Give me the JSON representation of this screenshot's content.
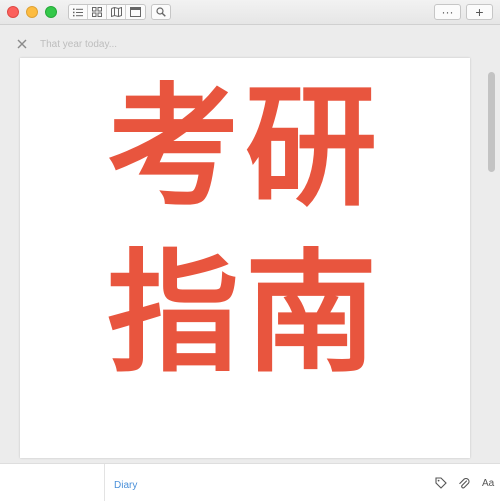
{
  "window": {
    "controls": [
      "close",
      "minimize",
      "zoom"
    ]
  },
  "toolbar": {
    "view_buttons": [
      {
        "icon": "list-icon"
      },
      {
        "icon": "grid-icon"
      },
      {
        "icon": "map-icon"
      },
      {
        "icon": "calendar-icon"
      }
    ],
    "search_icon": "magnifier-icon",
    "more_label": "···",
    "add_label": "+"
  },
  "entry": {
    "title_placeholder": "That year today...",
    "poster_line_1": "考研",
    "poster_line_2": "指南",
    "poster_color": "#e8553e"
  },
  "footer": {
    "journal": "Diary",
    "tools": [
      "tag-icon",
      "paperclip-icon"
    ],
    "font_label": "Aa"
  },
  "colors": {
    "accent": "#4a90d9",
    "poster": "#e8553e"
  }
}
